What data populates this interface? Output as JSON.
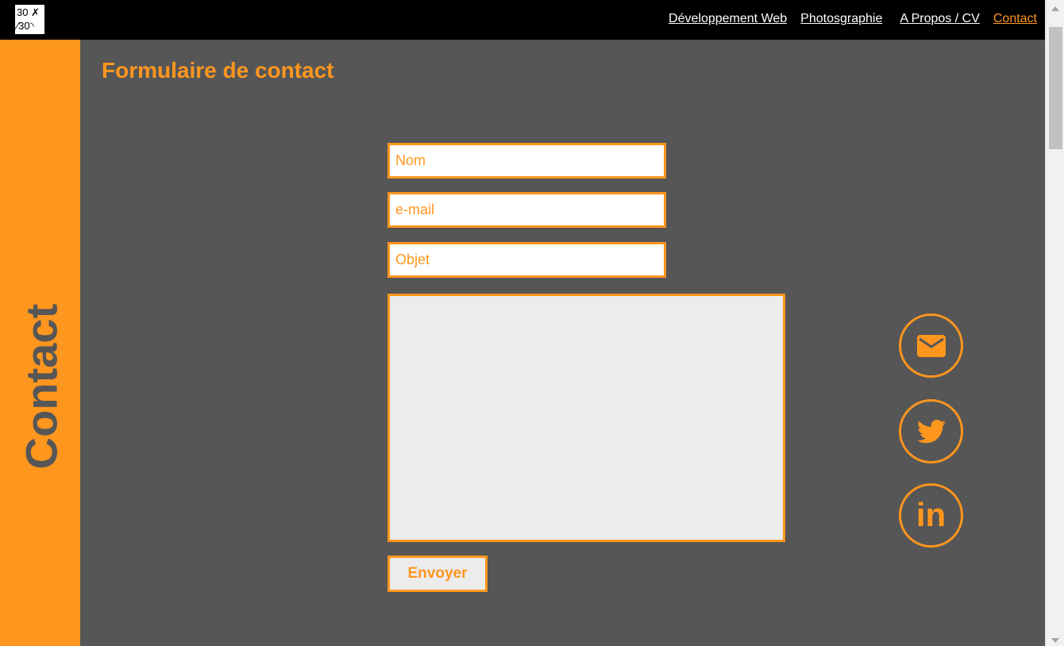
{
  "header": {
    "logo_line1": "30 ✗",
    "logo_line2": "⁄30◝",
    "nav": [
      {
        "label": "Développement Web"
      },
      {
        "label": "Photosgraphie"
      },
      {
        "label": "A Propos / CV"
      },
      {
        "label": "Contact",
        "active": true
      }
    ]
  },
  "sidebar": {
    "label": "Contact"
  },
  "main": {
    "title": "Formulaire de contact",
    "form": {
      "name_placeholder": "Nom",
      "email_placeholder": "e-mail",
      "subject_placeholder": "Objet",
      "message_value": "",
      "submit_label": "Envoyer"
    },
    "social": {
      "email_icon": "envelope-icon",
      "twitter_icon": "twitter-bird-icon",
      "linkedin_text": "in"
    }
  },
  "colors": {
    "accent": "#ff961e",
    "background": "#565656",
    "header": "#000000",
    "textarea_bg": "#ececec"
  }
}
